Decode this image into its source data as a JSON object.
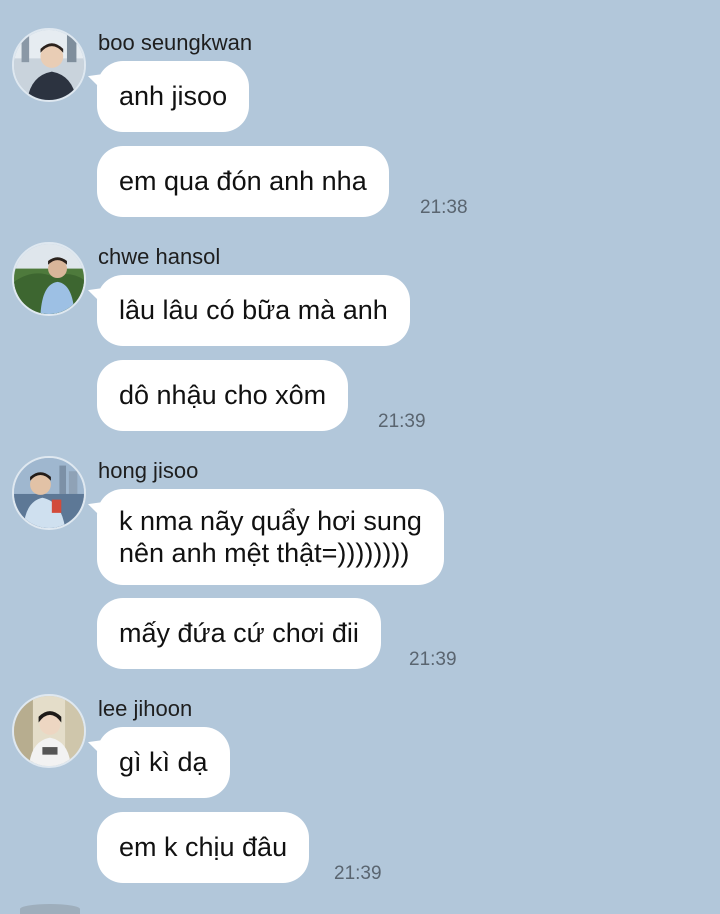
{
  "messages": [
    {
      "sender": "boo seungkwan",
      "bubbles": [
        "anh jisoo",
        "em qua đón anh nha"
      ],
      "time": "21:38"
    },
    {
      "sender": "chwe hansol",
      "bubbles": [
        "lâu lâu có bữa mà anh",
        "dô nhậu cho xôm"
      ],
      "time": "21:39"
    },
    {
      "sender": "hong jisoo",
      "bubbles": [
        "k nma nãy quẩy hơi sung",
        "nên anh mệt thật=))))))))",
        "mấy đứa cứ chơi đii"
      ],
      "time": "21:39"
    },
    {
      "sender": "lee jihoon",
      "bubbles": [
        "gì kì dạ",
        "em k chịu đâu"
      ],
      "time": "21:39"
    }
  ],
  "colors": {
    "background": "#b2c7da",
    "bubble": "#ffffff",
    "time_text": "#5a6570"
  }
}
